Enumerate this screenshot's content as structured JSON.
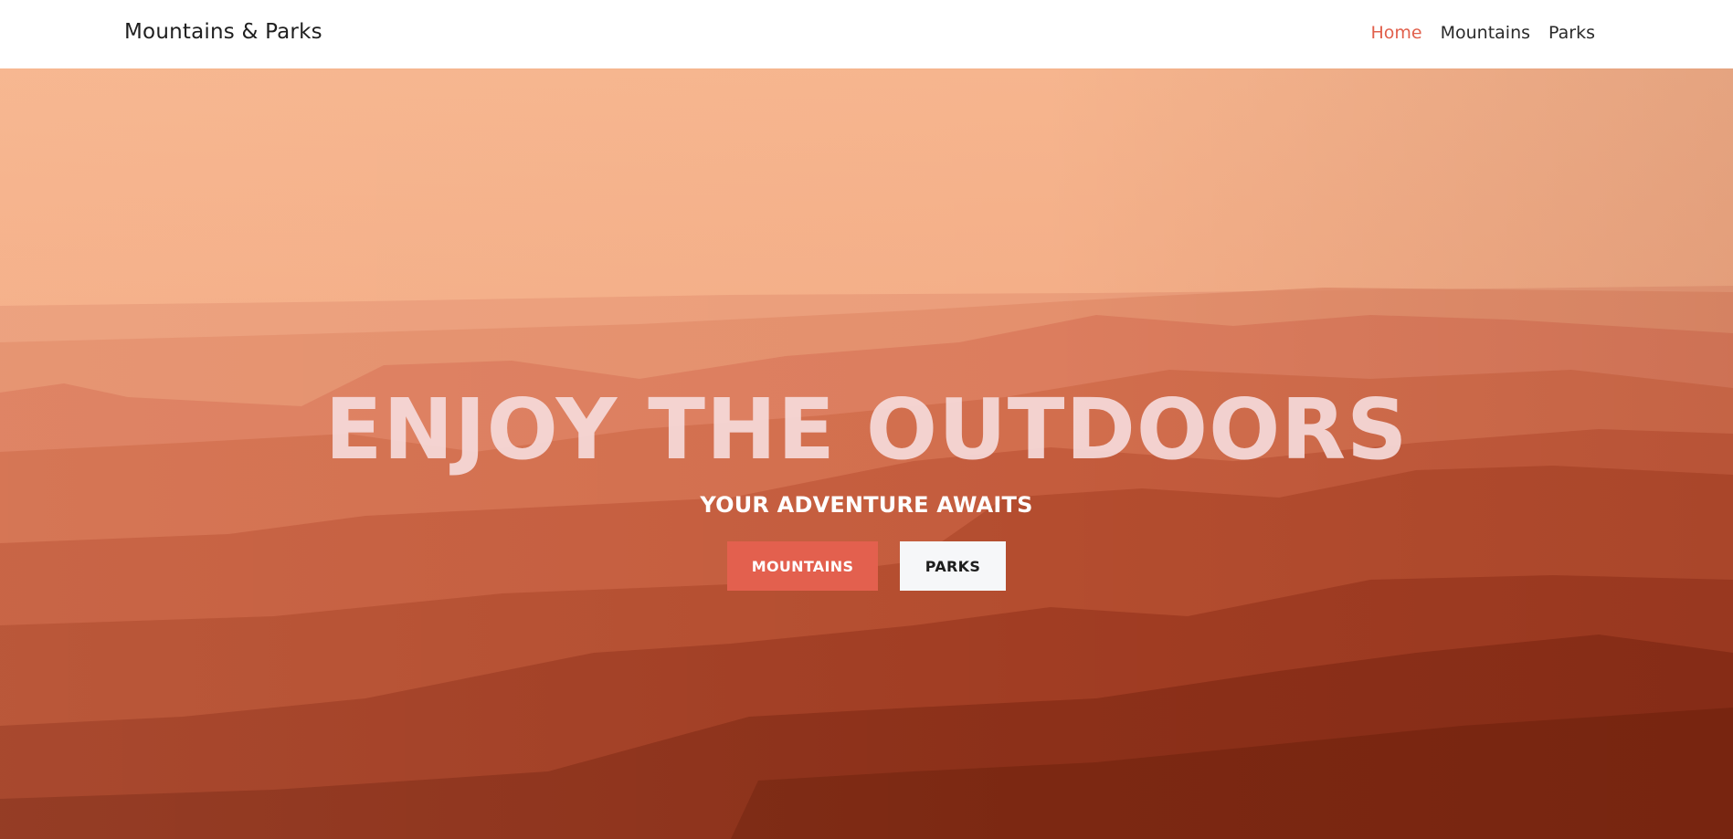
{
  "navbar": {
    "brand": "Mountains & Parks",
    "links": [
      {
        "label": "Home",
        "active": true
      },
      {
        "label": "Mountains",
        "active": false
      },
      {
        "label": "Parks",
        "active": false
      }
    ]
  },
  "hero": {
    "title": "ENJOY THE OUTDOORS",
    "subtitle": "YOUR ADVENTURE AWAITS",
    "buttons": {
      "primary": "MOUNTAINS",
      "secondary": "PARKS"
    }
  },
  "colors": {
    "accent": "#e3604e",
    "nav_active": "#e1604c"
  }
}
